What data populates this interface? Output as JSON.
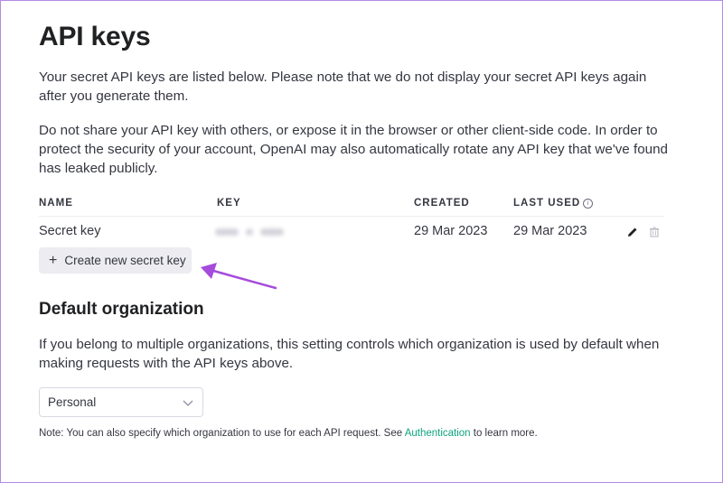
{
  "page": {
    "title": "API keys",
    "intro_1": "Your secret API keys are listed below. Please note that we do not display your secret API keys again after you generate them.",
    "intro_2": "Do not share your API key with others, or expose it in the browser or other client-side code. In order to protect the security of your account, OpenAI may also automatically rotate any API key that we've found has leaked publicly."
  },
  "table": {
    "headers": {
      "name": "NAME",
      "key": "KEY",
      "created": "CREATED",
      "last_used": "LAST USED"
    },
    "rows": [
      {
        "name": "Secret key",
        "key": "sk-...••••",
        "created": "29 Mar 2023",
        "last_used": "29 Mar 2023"
      }
    ],
    "row_icons": [
      "pencil-icon",
      "trash-icon"
    ]
  },
  "create_button": {
    "label": "Create new secret key",
    "icon": "plus-icon"
  },
  "default_org": {
    "heading": "Default organization",
    "description": "If you belong to multiple organizations, this setting controls which organization is used by default when making requests with the API keys above.",
    "selected": "Personal"
  },
  "note": {
    "before": "Note: You can also specify which organization to use for each API request. See ",
    "link": "Authentication",
    "after": " to learn more."
  },
  "colors": {
    "accent_link": "#10a37f",
    "annotation_arrow": "#a64bdc",
    "button_bg": "#ececf1"
  }
}
